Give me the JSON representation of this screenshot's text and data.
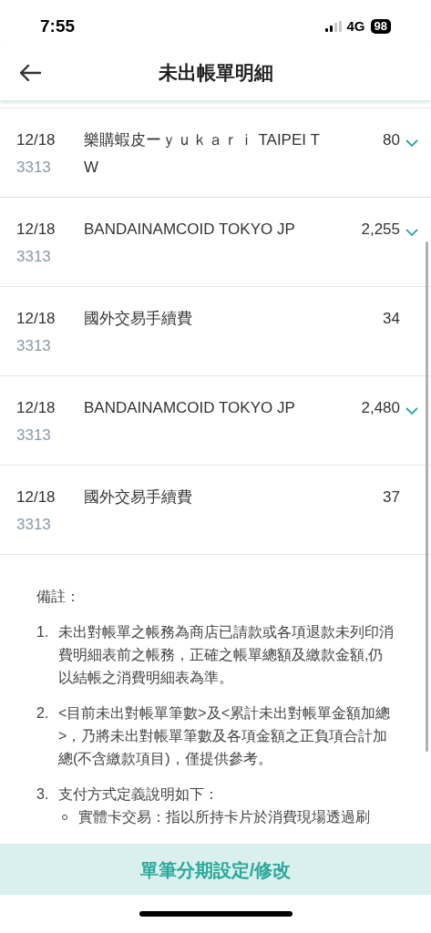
{
  "status_bar": {
    "time": "7:55",
    "network": "4G",
    "battery": "98"
  },
  "header": {
    "title": "未出帳單明細"
  },
  "transactions": [
    {
      "date": "12/18",
      "card": "3313",
      "description": "樂購蝦皮ーｙｕｋａｒｉ TAIPEI TW",
      "amount": "80",
      "expandable": true
    },
    {
      "date": "12/18",
      "card": "3313",
      "description": "BANDAINAMCOID TOKYO JP",
      "amount": "2,255",
      "expandable": true
    },
    {
      "date": "12/18",
      "card": "3313",
      "description": "國外交易手續費",
      "amount": "34",
      "expandable": false
    },
    {
      "date": "12/18",
      "card": "3313",
      "description": "BANDAINAMCOID TOKYO JP",
      "amount": "2,480",
      "expandable": true
    },
    {
      "date": "12/18",
      "card": "3313",
      "description": "國外交易手續費",
      "amount": "37",
      "expandable": false
    }
  ],
  "notes": {
    "title": "備註：",
    "items": [
      {
        "number": "1.",
        "text": "未出對帳單之帳務為商店已請款或各項退款未列印消費明細表前之帳務，正確之帳單總額及繳款金額,仍以結帳之消費明細表為準。"
      },
      {
        "number": "2.",
        "text": "<目前未出對帳單筆數>及<累計未出對帳單金額加總>，乃將未出對帳單筆數及各項金額之正負項合計加總(不含繳款項目)，僅提供參考。"
      },
      {
        "number": "3.",
        "text": "支付方式定義說明如下：",
        "bullets": [
          "實體卡交易：指以所持卡片於消費現場透過刷"
        ]
      }
    ]
  },
  "action_button": {
    "label": "單筆分期設定/修改"
  }
}
